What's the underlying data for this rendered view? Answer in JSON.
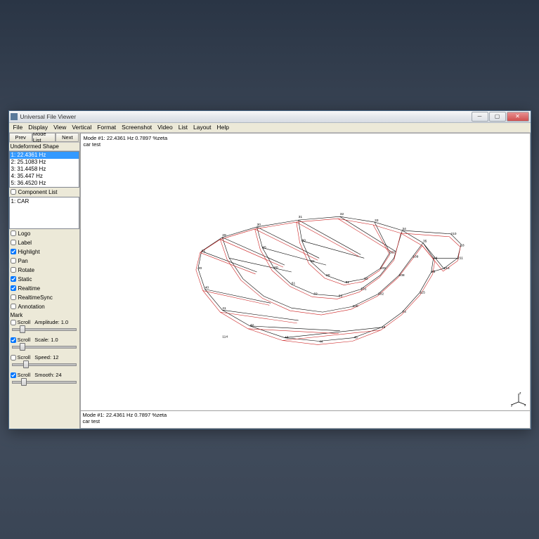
{
  "window": {
    "title": "Universal File Viewer"
  },
  "menubar": [
    "File",
    "Display",
    "View",
    "Vertical",
    "Format",
    "Screenshot",
    "Video",
    "List",
    "Layout",
    "Help"
  ],
  "nav": {
    "prev": "Prev",
    "mode_list": "Mode List",
    "next": "Next"
  },
  "mode_list_header": "Undeformed Shape",
  "modes": [
    "1: 22.4361 Hz",
    "2: 25.1083 Hz",
    "3: 31.4458 Hz",
    "4: 35.447 Hz",
    "5: 36.4520 Hz"
  ],
  "component_list_label": "Component List",
  "components": [
    "1: CAR"
  ],
  "toggles": [
    {
      "label": "Logo",
      "checked": false
    },
    {
      "label": "Label",
      "checked": false
    },
    {
      "label": "Highlight",
      "checked": true
    },
    {
      "label": "Pan",
      "checked": false
    },
    {
      "label": "Rotate",
      "checked": false
    },
    {
      "label": "Static",
      "checked": true
    },
    {
      "label": "Realtime",
      "checked": true
    },
    {
      "label": "RealtimeSync",
      "checked": false
    },
    {
      "label": "Annotation",
      "checked": false
    }
  ],
  "mark_section": "Mark",
  "sliders": [
    {
      "scroll": "Scroll",
      "label": "Amplitude: 1.0",
      "checked": false,
      "pos": 10
    },
    {
      "scroll": "Scroll",
      "label": "Scale: 1.0",
      "checked": true,
      "pos": 10
    },
    {
      "scroll": "Scroll",
      "label": "Speed: 12",
      "checked": false,
      "pos": 15
    },
    {
      "scroll": "Scroll",
      "label": "Smooth: 24",
      "checked": true,
      "pos": 12
    }
  ],
  "viewport": {
    "header_line1": "Mode #1: 22.4361 Hz   0.7897 %zeta",
    "header_line2": "car test"
  },
  "status": {
    "line1": "Mode #1: 22.4361 Hz   0.7897 %zeta",
    "line2": "car test"
  }
}
